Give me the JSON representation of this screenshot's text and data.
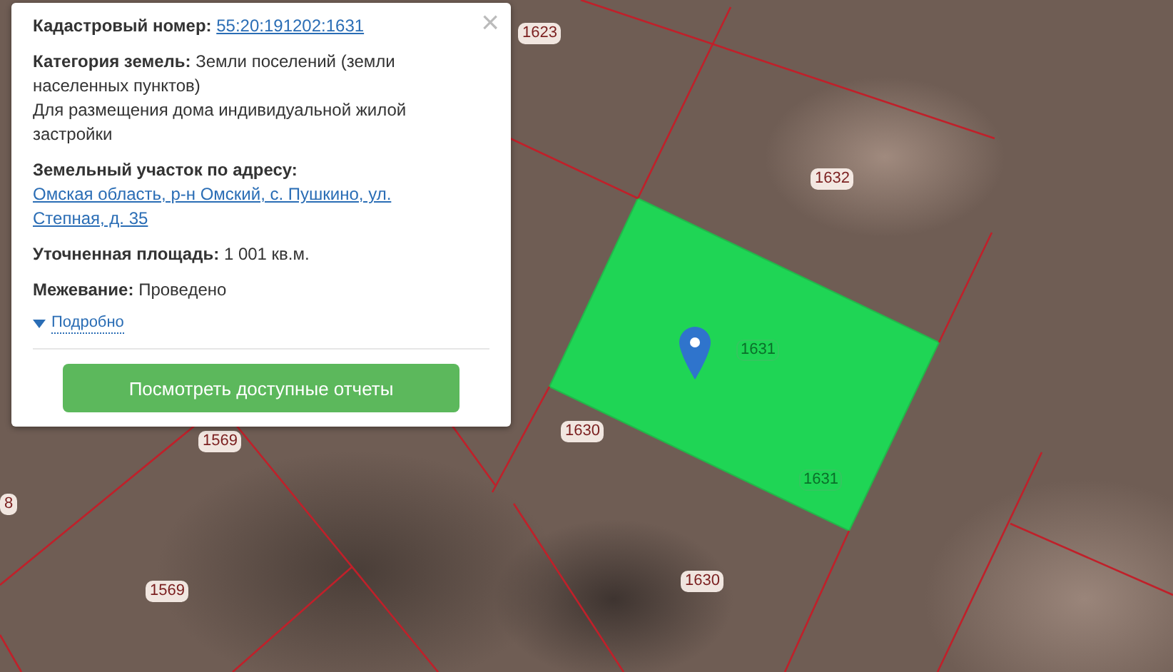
{
  "popup": {
    "close": "×",
    "fields": [
      {
        "kind": "link",
        "label": "Кадастровый номер:",
        "value": "55:20:191202:1631"
      },
      {
        "kind": "text",
        "label": "Категория земель:",
        "value": "Земли поселений (земли населенных пунктов)",
        "note": "Для размещения дома индивидуальной жилой застройки"
      },
      {
        "kind": "link",
        "label": "Земельный участок по адресу:",
        "value": "Омская область, р-н Омский, с. Пушкино, ул. Степная, д. 35"
      },
      {
        "kind": "text",
        "label": "Уточненная площадь:",
        "value": "1 001 кв.м."
      },
      {
        "kind": "text",
        "label": "Межевание:",
        "value": "Проведено"
      }
    ],
    "details_link": "Подробно",
    "button": "Посмотреть доступные отчеты"
  },
  "map": {
    "labels": [
      {
        "text": "1623",
        "kind": "parcel"
      },
      {
        "text": "1632",
        "kind": "parcel"
      },
      {
        "text": "1631",
        "kind": "selected"
      },
      {
        "text": "1631",
        "kind": "selected"
      },
      {
        "text": "1630",
        "kind": "parcel"
      },
      {
        "text": "1630",
        "kind": "parcel"
      },
      {
        "text": "1569",
        "kind": "parcel"
      },
      {
        "text": "1569",
        "kind": "parcel"
      },
      {
        "text": "8",
        "kind": "parcel"
      }
    ]
  }
}
